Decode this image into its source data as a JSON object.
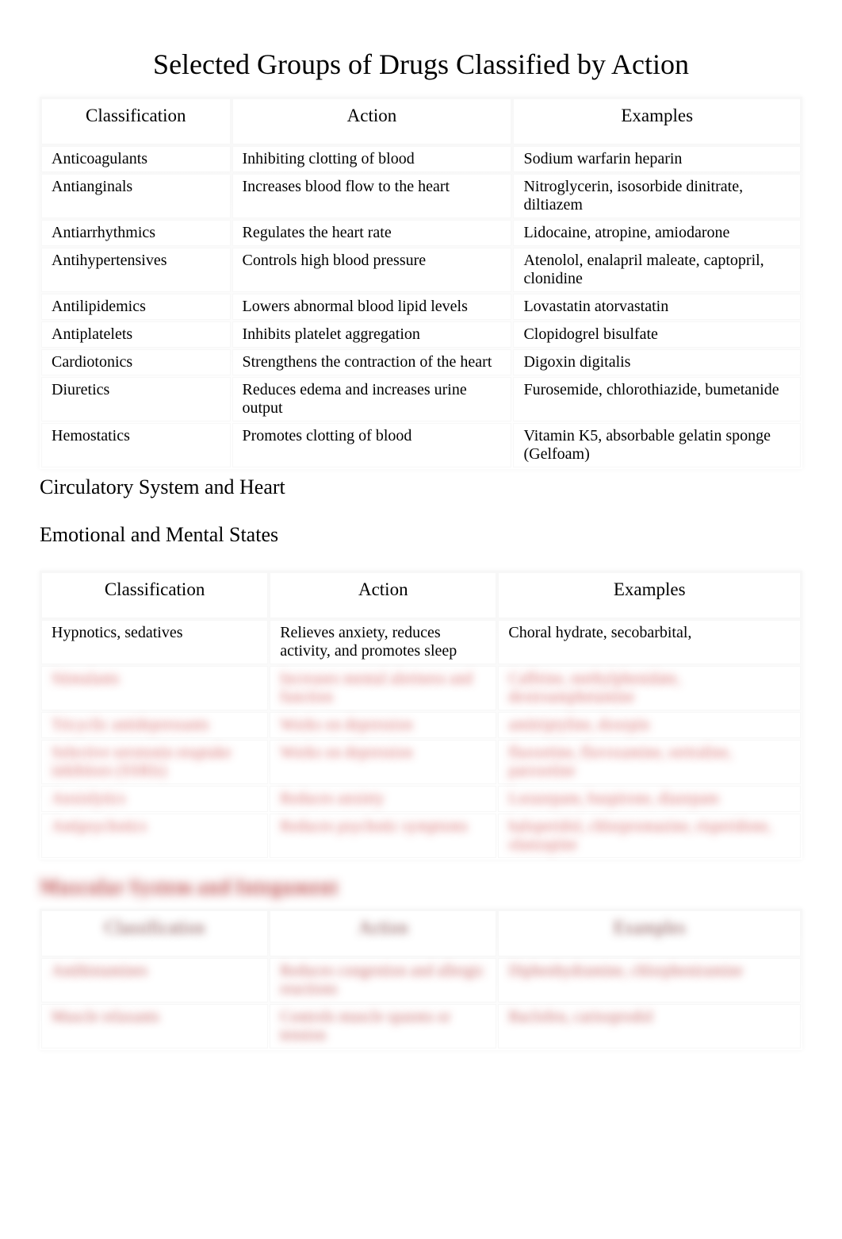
{
  "title": "Selected Groups of Drugs Classified by Action",
  "headers": {
    "classification": "Classification",
    "action": "Action",
    "examples": "Examples"
  },
  "section1": {
    "caption": "Circulatory System and Heart",
    "rows": [
      {
        "c": "Anticoagulants",
        "a": "Inhibiting clotting of blood",
        "e": "Sodium warfarin heparin"
      },
      {
        "c": "Antianginals",
        "a": "Increases blood flow to the heart",
        "e": "Nitroglycerin, isosorbide dinitrate, diltiazem"
      },
      {
        "c": "Antiarrhythmics",
        "a": "Regulates the heart rate",
        "e": "Lidocaine, atropine, amiodarone"
      },
      {
        "c": "Antihypertensives",
        "a": "Controls high blood pressure",
        "e": "Atenolol, enalapril maleate, captopril, clonidine"
      },
      {
        "c": "Antilipidemics",
        "a": "Lowers abnormal blood lipid levels",
        "e": "Lovastatin atorvastatin"
      },
      {
        "c": "Antiplatelets",
        "a": "Inhibits platelet aggregation",
        "e": "Clopidogrel bisulfate"
      },
      {
        "c": "Cardiotonics",
        "a": "Strengthens the contraction of the heart",
        "e": "Digoxin digitalis"
      },
      {
        "c": "Diuretics",
        "a": "Reduces edema and increases urine output",
        "e": "Furosemide, chlorothiazide, bumetanide"
      },
      {
        "c": "Hemostatics",
        "a": "Promotes clotting of blood",
        "e": "Vitamin K5, absorbable gelatin sponge (Gelfoam)"
      }
    ]
  },
  "section2": {
    "caption": "Emotional and Mental States",
    "rows": [
      {
        "c": "Hypnotics, sedatives",
        "a": "Relieves anxiety, reduces activity, and promotes sleep",
        "e": "Choral hydrate, secobarbital,",
        "blurred": false
      },
      {
        "c": "Stimulants",
        "a": "Increases mental alertness and function",
        "e": "Caffeine, methylphenidate, dextroamphetamine",
        "blurred": true
      },
      {
        "c": "Tricyclic antidepressants",
        "a": "Works on depression",
        "e": "amitriptyline, doxepin",
        "blurred": true
      },
      {
        "c": "Selective serotonin reuptake inhibitors (SSRIs)",
        "a": "Works on depression",
        "e": "fluoxetine, fluvoxamine, sertraline, paroxetine",
        "blurred": true
      },
      {
        "c": "Anxiolytics",
        "a": "Reduces anxiety",
        "e": "Lorazepam, buspirone, diazepam",
        "blurred": true
      },
      {
        "c": "Antipsychotics",
        "a": "Reduces psychotic symptoms",
        "e": "haloperidol, chlorpromazine, risperidone, olanzapine",
        "blurred": true
      }
    ]
  },
  "section3": {
    "caption": "Muscular System and Integument",
    "rows": [
      {
        "c": "Antihistamines",
        "a": "Reduces congestion and allergic reactions",
        "e": "Diphenhydramine, chlorpheniramine"
      },
      {
        "c": "Muscle relaxants",
        "a": "Controls muscle spasms or tension",
        "e": "Baclofen, carisoprodol"
      }
    ]
  }
}
